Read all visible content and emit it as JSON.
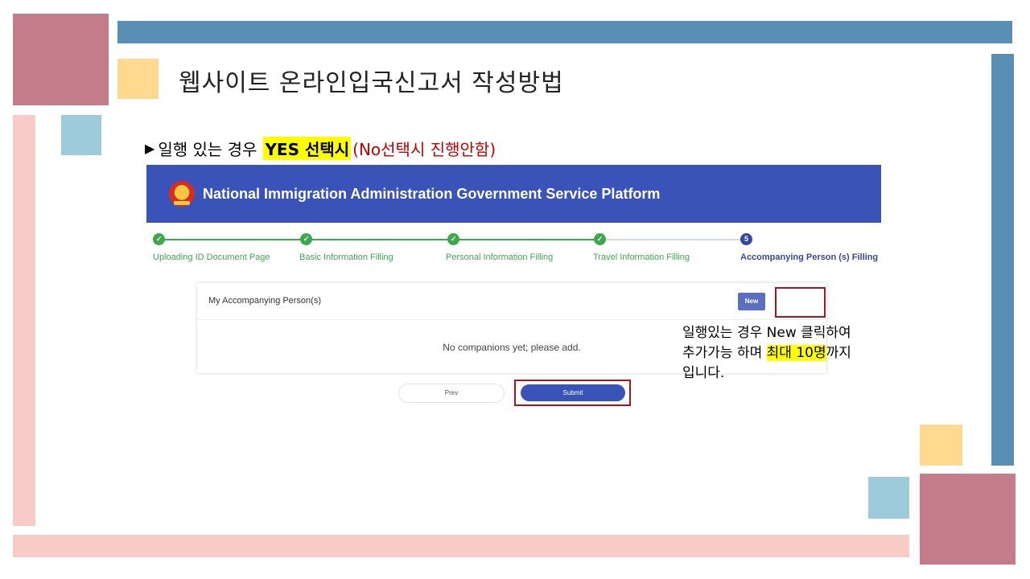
{
  "slide": {
    "title": "웹사이트 온라인입국신고서 작성방법",
    "subtitle": {
      "marker": "▶",
      "lead": "일행 있는 경우",
      "highlight": "YES 선택시",
      "note": "(No선택시 진행안함)"
    },
    "annotation": {
      "line1": "일행있는 경우 New 클릭하여",
      "line2_prefix": "추가가능 하며 ",
      "line2_highlight": "최대 10명",
      "line2_suffix": "까지",
      "line3": "입니다."
    }
  },
  "screenshot": {
    "platform_title": "National Immigration Administration Government Service Platform",
    "steps": [
      {
        "number": "✓",
        "label": "Uploading ID Document Page",
        "state": "done"
      },
      {
        "number": "✓",
        "label": "Basic Information Filling",
        "state": "done"
      },
      {
        "number": "✓",
        "label": "Personal Information Filling",
        "state": "done"
      },
      {
        "number": "✓",
        "label": "Travel Information Filling",
        "state": "done"
      },
      {
        "number": "5",
        "label": "Accompanying Person (s) Filling",
        "state": "active"
      }
    ],
    "card_title": "My Accompanying Person(s)",
    "new_button": "New",
    "empty_message": "No companions yet; please add.",
    "prev_button": "Prev",
    "submit_button": "Submit"
  },
  "colors": {
    "header_blue": "#3a53b8",
    "step_green": "#3ea84f",
    "step_active": "#35489c",
    "highlight_red_box": "#a8151b",
    "deco_rose": "#c47b8a",
    "deco_steel_blue": "#5a8fb5",
    "deco_light_blue": "#9ecbdc",
    "deco_peach": "#ffd990",
    "deco_pink": "#f9cbc6"
  }
}
